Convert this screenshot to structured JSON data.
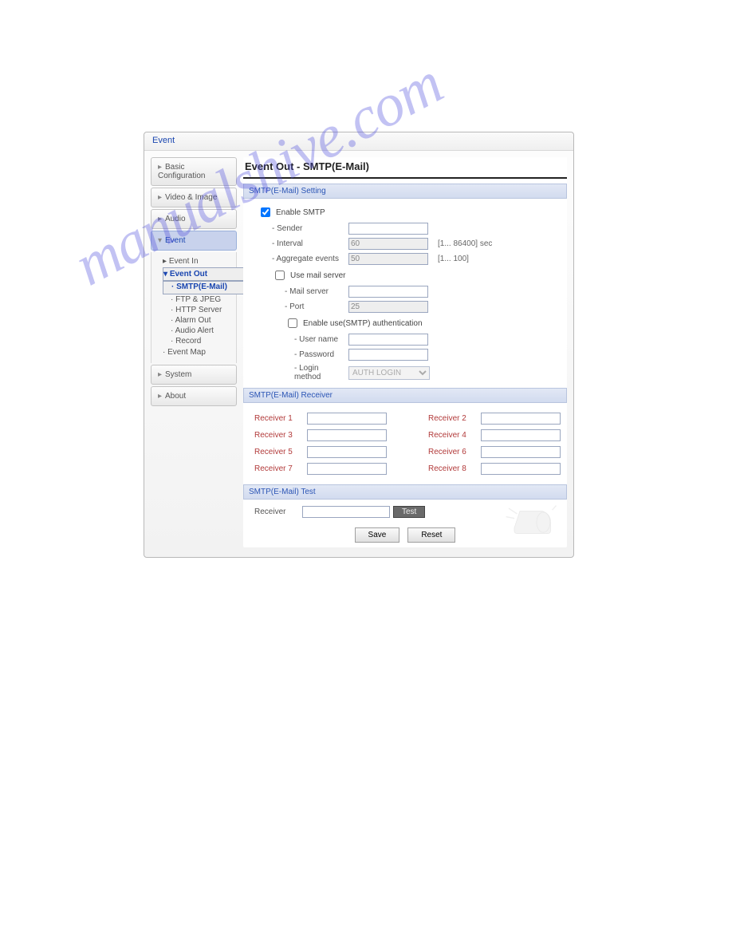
{
  "watermark": "manualshive.com",
  "titlebar": "Event",
  "sidebar": {
    "basic": "Basic Configuration",
    "video": "Video & Image",
    "audio": "Audio",
    "event": "Event",
    "system": "System",
    "about": "About"
  },
  "tree": {
    "event_in": "Event In",
    "event_out": "Event Out",
    "smtp": "SMTP(E-Mail)",
    "ftp": "FTP & JPEG",
    "http": "HTTP Server",
    "alarm": "Alarm Out",
    "audio_alert": "Audio Alert",
    "record": "Record",
    "event_map": "Event Map"
  },
  "page_title": "Event Out - SMTP(E-Mail)",
  "sections": {
    "setting": "SMTP(E-Mail) Setting",
    "receiver": "SMTP(E-Mail) Receiver",
    "test": "SMTP(E-Mail) Test"
  },
  "setting": {
    "enable_smtp": "Enable SMTP",
    "sender": "- Sender",
    "interval": "- Interval",
    "interval_val": "60",
    "interval_suf": "[1... 86400] sec",
    "aggregate": "- Aggregate events",
    "aggregate_val": "50",
    "aggregate_suf": "[1... 100]",
    "use_mail_server": "Use mail server",
    "mail_server": "- Mail server",
    "port": "- Port",
    "port_val": "25",
    "enable_auth": "Enable use(SMTP) authentication",
    "user": "- User name",
    "password": "- Password",
    "login_method": "- Login method",
    "login_method_val": "AUTH LOGIN"
  },
  "receiver": {
    "r1": "Receiver 1",
    "r2": "Receiver 2",
    "r3": "Receiver 3",
    "r4": "Receiver 4",
    "r5": "Receiver 5",
    "r6": "Receiver 6",
    "r7": "Receiver 7",
    "r8": "Receiver 8"
  },
  "test": {
    "label": "Receiver",
    "btn": "Test"
  },
  "actions": {
    "save": "Save",
    "reset": "Reset"
  }
}
